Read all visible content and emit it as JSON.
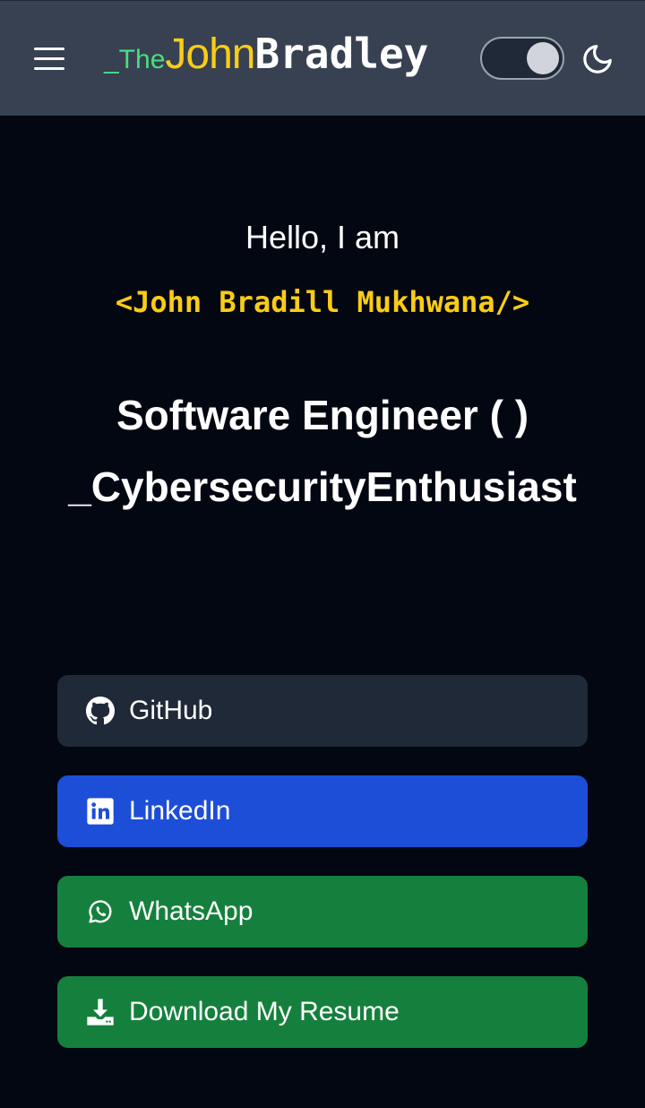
{
  "header": {
    "logo": {
      "prefix": "_The",
      "first": "John",
      "last": "Bradley"
    },
    "theme_toggle_state": "dark",
    "colors": {
      "background": "#374151",
      "logo_prefix": "#4ade80",
      "logo_first": "#facc15",
      "logo_last": "#ffffff"
    }
  },
  "hero": {
    "greeting": "Hello, I am",
    "name_tag": "<John Bradill Mukhwana/>",
    "role_line1": "Software Engineer ( )",
    "role_line2": "_CybersecurityEnthusiast",
    "colors": {
      "background": "#030712",
      "name_tag": "#facc15"
    }
  },
  "links": [
    {
      "label": "GitHub",
      "icon": "github-icon",
      "color": "#1f2937"
    },
    {
      "label": "LinkedIn",
      "icon": "linkedin-icon",
      "color": "#1d4ed8"
    },
    {
      "label": "WhatsApp",
      "icon": "whatsapp-icon",
      "color": "#15803d"
    },
    {
      "label": "Download My Resume",
      "icon": "download-icon",
      "color": "#15803d"
    }
  ]
}
